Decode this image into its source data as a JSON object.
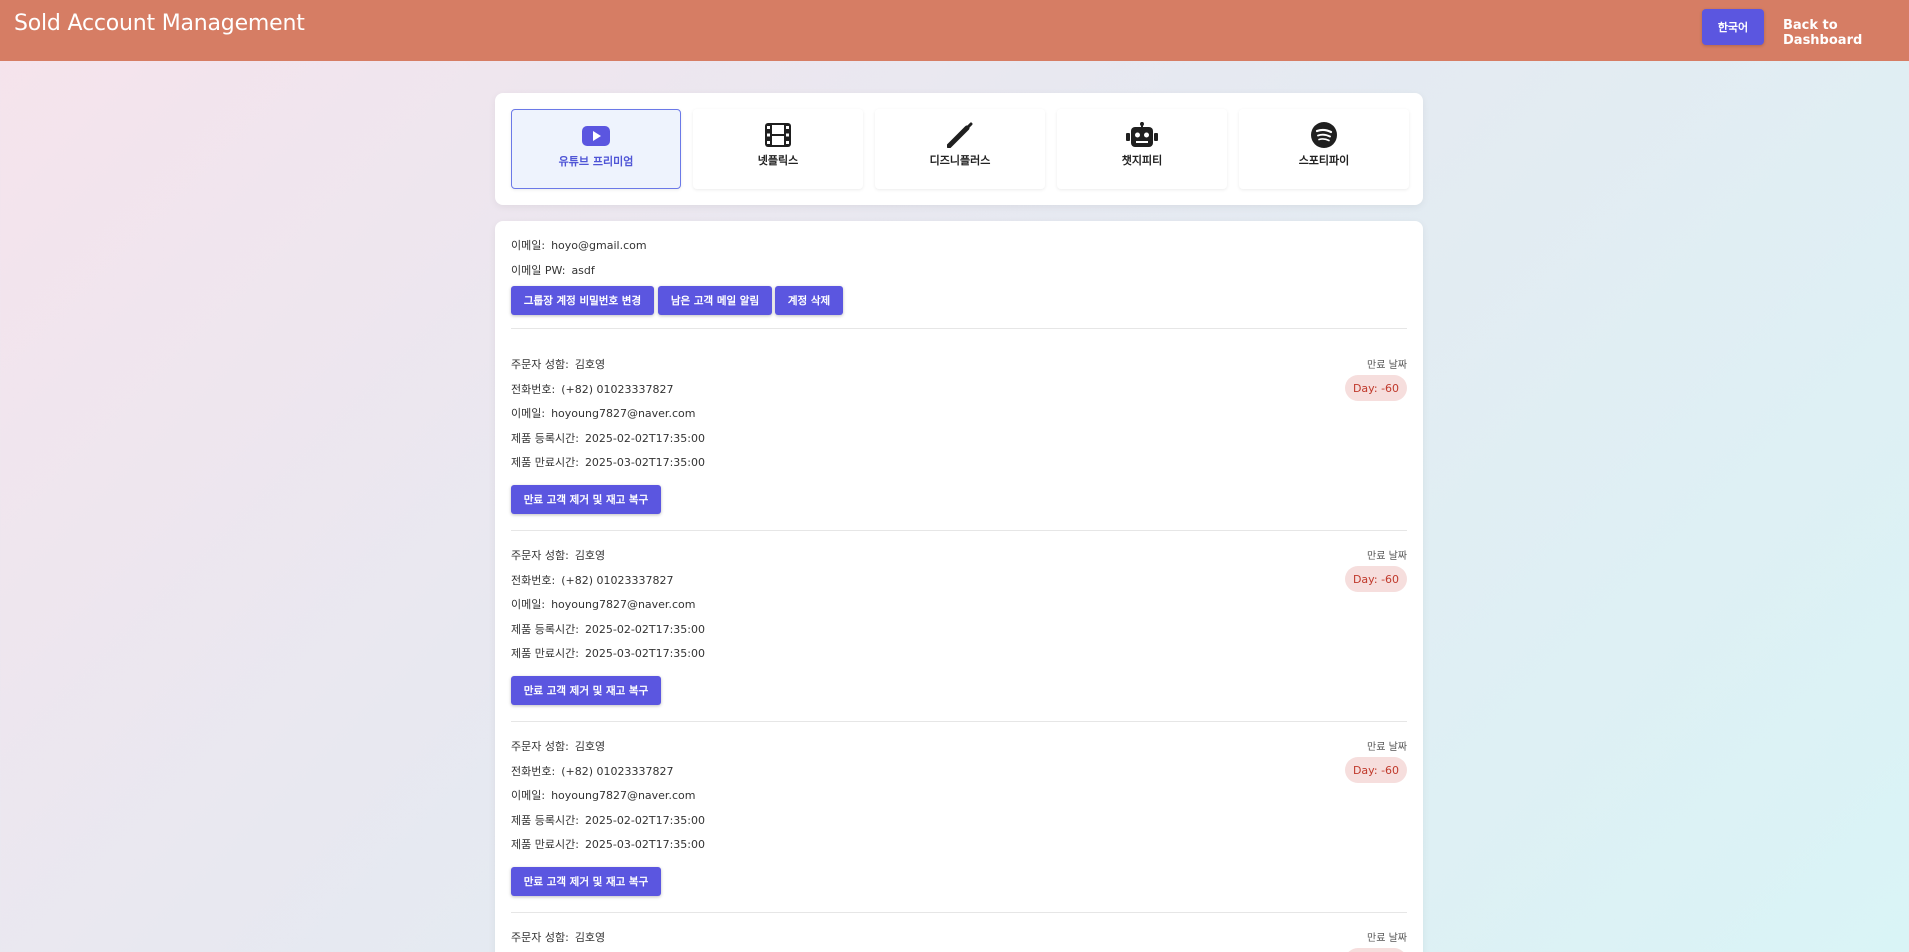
{
  "header": {
    "title": "Sold Account Management",
    "language_button": "한국어",
    "back_link": "Back to Dashboard"
  },
  "tabs": [
    {
      "label": "유튜브 프리미엄",
      "icon": "youtube-icon",
      "active": true
    },
    {
      "label": "넷플릭스",
      "icon": "film-icon",
      "active": false
    },
    {
      "label": "디즈니플러스",
      "icon": "magic-wand-icon",
      "active": false
    },
    {
      "label": "챗지피티",
      "icon": "robot-icon",
      "active": false
    },
    {
      "label": "스포티파이",
      "icon": "spotify-icon",
      "active": false
    }
  ],
  "account": {
    "email_label": "이메일:",
    "email": "hoyo@gmail.com",
    "pw_label": "이메일 PW:",
    "pw": "asdf",
    "actions": {
      "change_password": "그룹장 계정 비밀번호 변경",
      "notify_remaining": "남은 고객 메일 알림",
      "delete_account": "계정 삭제"
    }
  },
  "labels": {
    "name": "주문자 성함:",
    "phone": "전화번호:",
    "email": "이메일:",
    "registered": "제품 등록시간:",
    "expires": "제품 만료시간:",
    "expiry_date": "만료 날짜",
    "remove_button": "만료 고객 제거 및 재고 복구"
  },
  "customers": [
    {
      "name": "김호영",
      "phone": "(+82) 01023337827",
      "email": "hoyoung7827@naver.com",
      "registered": "2025-02-02T17:35:00",
      "expires": "2025-03-02T17:35:00",
      "day": "Day: -60"
    },
    {
      "name": "김호영",
      "phone": "(+82) 01023337827",
      "email": "hoyoung7827@naver.com",
      "registered": "2025-02-02T17:35:00",
      "expires": "2025-03-02T17:35:00",
      "day": "Day: -60"
    },
    {
      "name": "김호영",
      "phone": "(+82) 01023337827",
      "email": "hoyoung7827@naver.com",
      "registered": "2025-02-02T17:35:00",
      "expires": "2025-03-02T17:35:00",
      "day": "Day: -60"
    },
    {
      "name": "김호영"
    }
  ],
  "colors": {
    "header_bg": "#d67d64",
    "accent": "#5b56e0",
    "active_tab_text": "#4f55d6",
    "badge_bg": "#f6dedd",
    "badge_text": "#c0392b"
  }
}
